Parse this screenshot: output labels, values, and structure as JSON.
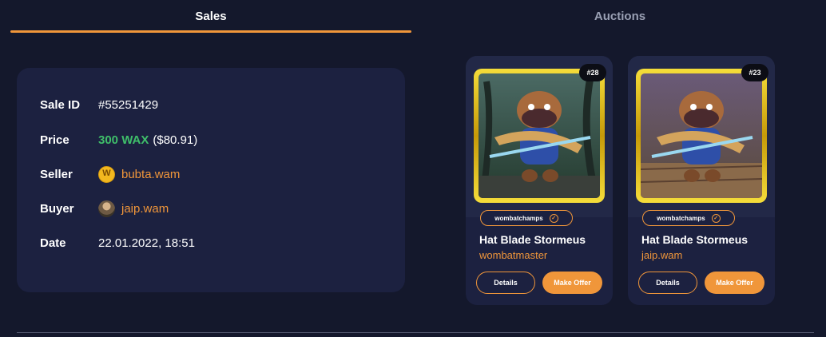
{
  "tabs": {
    "sales": "Sales",
    "auctions": "Auctions"
  },
  "sale": {
    "sale_id_label": "Sale ID",
    "sale_id": "#55251429",
    "price_label": "Price",
    "price_wax": "300 WAX",
    "price_usd": "($80.91)",
    "seller_label": "Seller",
    "seller": "bubta.wam",
    "seller_avatar_letter": "W",
    "buyer_label": "Buyer",
    "buyer": "jaip.wam",
    "date_label": "Date",
    "date": "22.01.2022, 18:51"
  },
  "cards": [
    {
      "number": "#28",
      "collection": "wombatchamps",
      "name": "Hat Blade Stormeus",
      "owner": "wombatmaster",
      "details": "Details",
      "offer": "Make Offer"
    },
    {
      "number": "#23",
      "collection": "wombatchamps",
      "name": "Hat Blade Stormeus",
      "owner": "jaip.wam",
      "details": "Details",
      "offer": "Make Offer"
    }
  ],
  "colors": {
    "accent": "#f0963a",
    "price_green": "#3fbf6a",
    "background": "#14182c",
    "card": "#1c2140",
    "gold_frame": "#e8c21c"
  },
  "icons": {
    "collection_verified": "check-circle-icon",
    "seller_avatar": "wax-coin-icon"
  }
}
